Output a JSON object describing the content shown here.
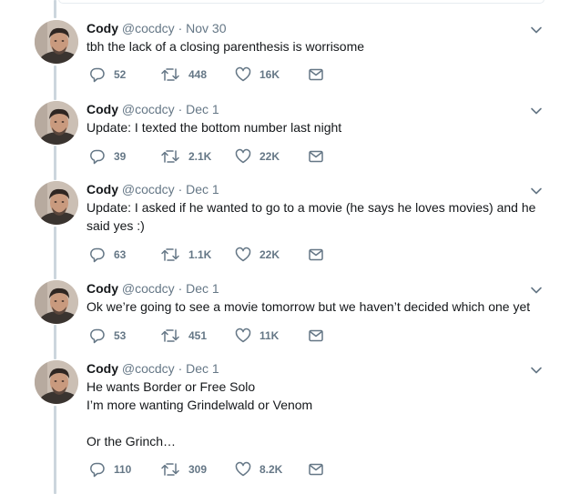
{
  "tweets": [
    {
      "name": "Cody",
      "handle": "@cocdcy",
      "dot": "·",
      "date": "Nov 30",
      "lines": [
        "tbh the lack of a closing parenthesis is worrisome"
      ],
      "replies": "52",
      "retweets": "448",
      "likes": "16K"
    },
    {
      "name": "Cody",
      "handle": "@cocdcy",
      "dot": "·",
      "date": "Dec 1",
      "lines": [
        "Update: I texted the bottom number last night"
      ],
      "replies": "39",
      "retweets": "2.1K",
      "likes": "22K"
    },
    {
      "name": "Cody",
      "handle": "@cocdcy",
      "dot": "·",
      "date": "Dec 1",
      "lines": [
        "Update: I asked if he wanted to go to a movie (he says he loves movies) and he",
        "said yes :)"
      ],
      "replies": "63",
      "retweets": "1.1K",
      "likes": "22K"
    },
    {
      "name": "Cody",
      "handle": "@cocdcy",
      "dot": "·",
      "date": "Dec 1",
      "lines": [
        "Ok we’re going to see a movie tomorrow but we haven’t decided which one yet"
      ],
      "replies": "53",
      "retweets": "451",
      "likes": "11K"
    },
    {
      "name": "Cody",
      "handle": "@cocdcy",
      "dot": "·",
      "date": "Dec 1",
      "lines": [
        "He wants Border or Free Solo",
        "I’m more wanting Grindelwald or Venom",
        "",
        "Or the Grinch…"
      ],
      "replies": "110",
      "retweets": "309",
      "likes": "8.2K"
    }
  ],
  "icons": {
    "reply": "reply-icon",
    "retweet": "retweet-icon",
    "like": "heart-icon",
    "message": "mail-icon",
    "caret": "chevron-down-icon"
  },
  "colors": {
    "text": "#14171a",
    "secondary": "#657786",
    "thread_line": "#ccd6dd",
    "background": "#ffffff"
  }
}
